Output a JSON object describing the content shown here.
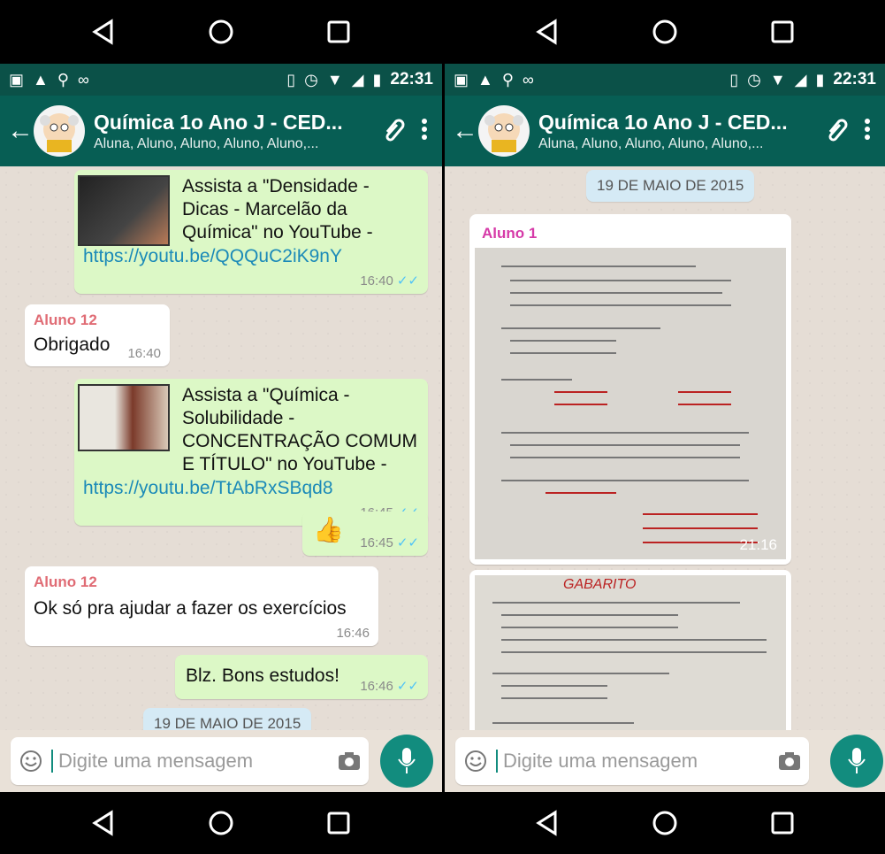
{
  "header": {
    "title": "Química 1o Ano J - CED...",
    "subtitle": "Aluna, Aluno, Aluno, Aluno, Aluno,..."
  },
  "status": {
    "time": "22:31"
  },
  "input": {
    "placeholder": "Digite uma mensagem"
  },
  "left_chat": {
    "msg1": {
      "text": "Assista a \"Densidade - Dicas - Marcelão da Química\" no YouTube - ",
      "link": "https://youtu.be/QQQuC2iK9nY",
      "time": "16:40"
    },
    "msg2": {
      "sender": "Aluno 12",
      "text": "Obrigado",
      "time": "16:40"
    },
    "msg3": {
      "text": "Assista a \"Química - Solubilidade - CONCENTRAÇÃO COMUM E TÍTULO\" no YouTube - ",
      "link": "https://youtu.be/TtAbRxSBqd8",
      "time": "16:45"
    },
    "msg4": {
      "emoji": "👍",
      "time": "16:45"
    },
    "msg5": {
      "sender": "Aluno 12",
      "text": "Ok só pra ajudar a fazer os exercícios",
      "time": "16:46"
    },
    "msg6": {
      "text": "Blz. Bons estudos!",
      "time": "16:46"
    },
    "partial_date": "19 DE MAIO DE 2015"
  },
  "right_chat": {
    "date": "19 DE MAIO DE 2015",
    "msg1": {
      "sender": "Aluno 1",
      "time": "21:16"
    },
    "paper2_label": "GABARITO"
  },
  "colors": {
    "appbar": "#075e54",
    "statusbar": "#0b5148",
    "out": "#dcf8c6",
    "mic": "#128c7e"
  }
}
